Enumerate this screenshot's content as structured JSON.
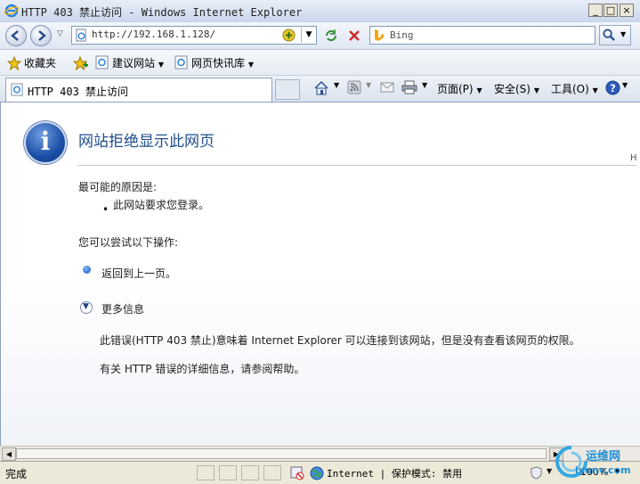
{
  "window": {
    "title": "HTTP 403 禁止访问 - Windows Internet Explorer",
    "minimize": "_",
    "maximize": "□",
    "close": "×"
  },
  "navigation": {
    "address": "http://192.168.1.128/",
    "search_placeholder": "Bing"
  },
  "favorites_bar": {
    "favorites_label": "收藏夹",
    "suggested_sites": "建议网站",
    "web_slice_gallery": "网页快讯库"
  },
  "tab": {
    "label": "HTTP 403 禁止访问"
  },
  "command_bar": {
    "page": "页面(P)",
    "safety": "安全(S)",
    "tools": "工具(O)"
  },
  "page": {
    "heading": "网站拒绝显示此网页",
    "cause_title": "最可能的原因是:",
    "cause_item": "此网站要求您登录。",
    "actions_title": "您可以尝试以下操作:",
    "go_back": "返回到上一页。",
    "more_info": "更多信息",
    "detail_1": "此错误(HTTP 403 禁止)意味着 Internet Explorer 可以连接到该网站，但是没有查看该网页的权限。",
    "detail_2": "有关 HTTP 错误的详细信息，请参阅帮助。",
    "cut_char": "H"
  },
  "status_bar": {
    "status": "完成",
    "zone": "Internet | 保护模式: 禁用",
    "zoom": "100%"
  },
  "watermark": {
    "text1": "运维网",
    "text2": "iyunv.com"
  }
}
